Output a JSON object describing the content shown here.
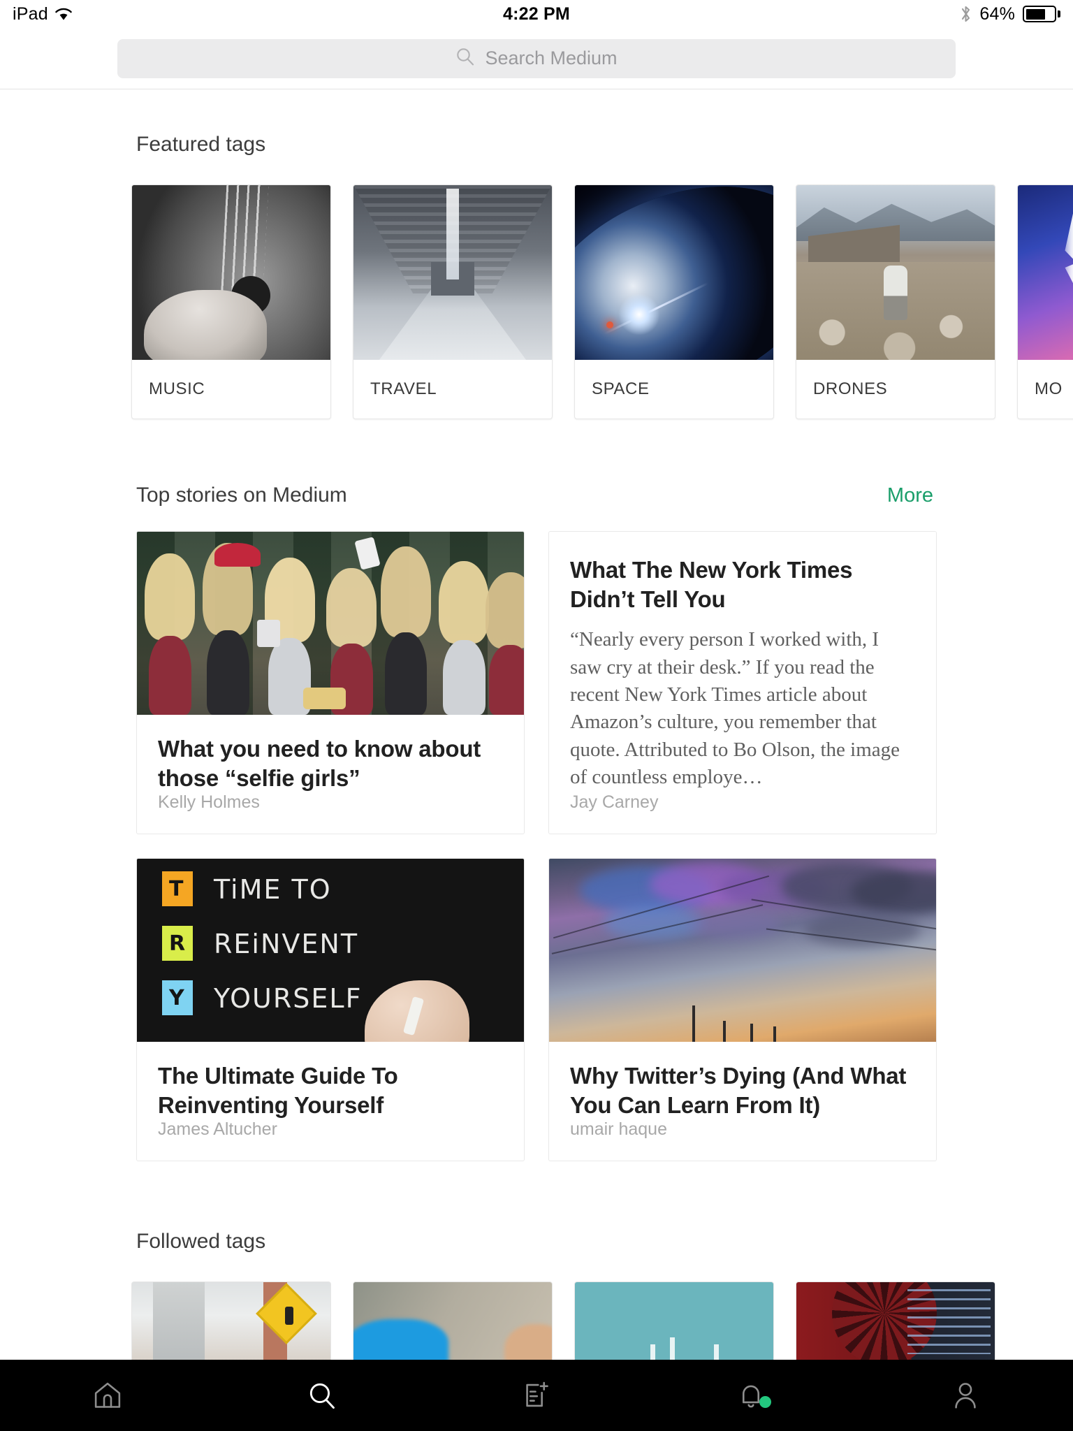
{
  "status_bar": {
    "device": "iPad",
    "wifi_icon": "wifi-icon",
    "time": "4:22 PM",
    "bluetooth_icon": "bluetooth-icon",
    "battery_percent": "64%",
    "battery_level": 64
  },
  "search": {
    "icon": "search-icon",
    "placeholder": "Search Medium",
    "value": ""
  },
  "featured": {
    "title": "Featured tags",
    "tags": [
      {
        "label": "MUSIC",
        "art": "art-music"
      },
      {
        "label": "TRAVEL",
        "art": "art-travel"
      },
      {
        "label": "SPACE",
        "art": "art-space"
      },
      {
        "label": "DRONES",
        "art": "art-drones"
      },
      {
        "label": "MO",
        "art": "art-movies"
      }
    ]
  },
  "top_stories": {
    "title": "Top stories on Medium",
    "more_label": "More",
    "more_color": "#1a9e6a",
    "cards": [
      {
        "title": "What you need to know about those “selfie girls”",
        "author": "Kelly Holmes",
        "excerpt": "",
        "has_image": true
      },
      {
        "title": "What The New York Times Didn’t Tell You",
        "author": "Jay Carney",
        "excerpt": "“Nearly every person I worked with, I saw cry at their desk.”\nIf you read the recent New York Times article about Amazon’s culture, you remember that quote. Attributed to Bo Olson, the image of countless employe…",
        "has_image": false
      },
      {
        "title": "The Ultimate Guide To Reinventing Yourself",
        "author": "James Altucher",
        "excerpt": "",
        "has_image": true
      },
      {
        "title": "Why Twitter’s Dying (And What You Can Learn From It)",
        "author": "umair haque",
        "excerpt": "",
        "has_image": true
      }
    ],
    "chalkboard_text": {
      "line1": "TiME TO",
      "line2": "REiNVENT",
      "line3": "YOURSELF",
      "letter1": "T",
      "letter2": "R",
      "letter3": "Y",
      "color1": "#f5a623",
      "color2": "#d9ed4a",
      "color3": "#7fd3f2"
    }
  },
  "followed": {
    "title": "Followed tags",
    "tags": [
      {
        "art": "ft1"
      },
      {
        "art": "ft2"
      },
      {
        "art": "ft3"
      },
      {
        "art": "ft4"
      }
    ]
  },
  "tabbar": {
    "items": [
      {
        "name": "home-icon",
        "label": "Home",
        "active": false
      },
      {
        "name": "search-icon",
        "label": "Search",
        "active": true
      },
      {
        "name": "new-story-icon",
        "label": "New story",
        "active": false
      },
      {
        "name": "notifications-icon",
        "label": "Notifications",
        "active": false,
        "badge": true
      },
      {
        "name": "profile-icon",
        "label": "Profile",
        "active": false
      }
    ],
    "badge_color": "#23c87f",
    "active_color": "#ffffff",
    "inactive_color": "#8e8e8e"
  }
}
